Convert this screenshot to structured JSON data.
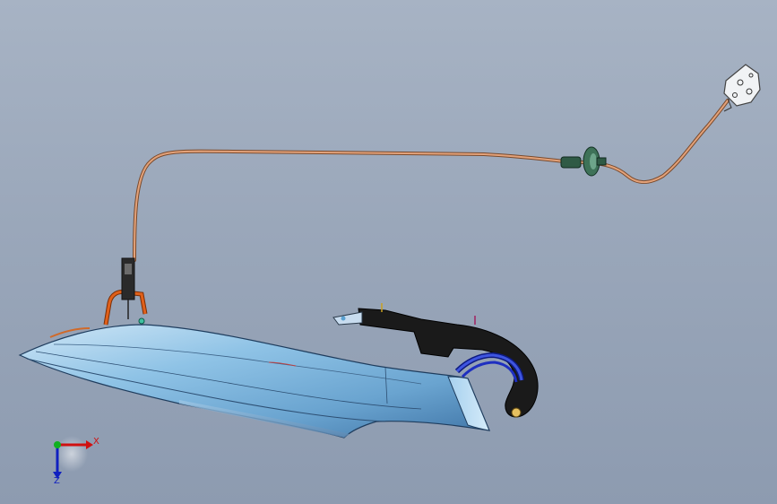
{
  "viewport": {
    "background_top": "#a7b3c4",
    "background_bottom": "#8d9bb0"
  },
  "model": {
    "cable_color": "#d9865a",
    "panel_color": "#7fb6dd",
    "bracket_color": "#1a1a1a",
    "hose_color": "#1e2fc0",
    "handle_color": "#e0601a",
    "grommet_color": "#2f5a45"
  },
  "triad": {
    "x_label": "X",
    "z_label": "Z",
    "x_color": "#d01010",
    "y_color": "#10b020",
    "z_color": "#1020c0"
  }
}
